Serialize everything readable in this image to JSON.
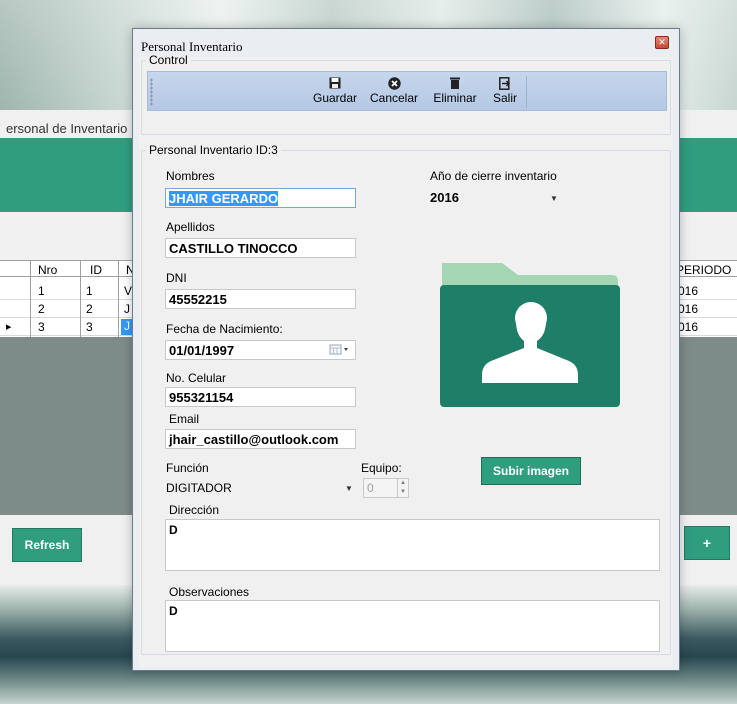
{
  "background": {
    "window_title": "ersonal de Inventario",
    "grid": {
      "headers": [
        "Nro",
        "ID",
        "N",
        "PERIODO"
      ],
      "rows": [
        {
          "nro": "1",
          "id": "1",
          "n": "V",
          "periodo": "016"
        },
        {
          "nro": "2",
          "id": "2",
          "n": "J",
          "periodo": "016"
        },
        {
          "nro": "3",
          "id": "3",
          "n": "J",
          "periodo": "016"
        }
      ]
    },
    "refresh_label": "Refresh",
    "add_label": "+",
    "accent_color": "#2f9e7f"
  },
  "dialog": {
    "title": "Personal Inventario",
    "control_group": "Control",
    "toolbar": {
      "save_label": "Guardar",
      "cancel_label": "Cancelar",
      "delete_label": "Eliminar",
      "exit_label": "Salir"
    },
    "form_group": "Personal Inventario ID:3",
    "fields": {
      "nombres_label": "Nombres",
      "nombres_value": "JHAIR GERARDO",
      "apellidos_label": "Apellidos",
      "apellidos_value": "CASTILLO TINOCCO",
      "dni_label": "DNI",
      "dni_value": "45552215",
      "fecha_label": "Fecha de Nacimiento:",
      "fecha_value": "01/01/1997",
      "celular_label": "No. Celular",
      "celular_value": "955321154",
      "email_label": "Email",
      "email_value": "jhair_castillo@outlook.com",
      "funcion_label": "Función",
      "funcion_value": "DIGITADOR",
      "equipo_label": "Equipo:",
      "equipo_value": "0",
      "direccion_label": "Dirección",
      "direccion_value": "D",
      "observaciones_label": "Observaciones",
      "observaciones_value": "D",
      "anio_label": "Año de cierre inventario",
      "anio_value": "2016"
    },
    "upload_label": "Subir imagen",
    "icons": {
      "save": "floppy-disk-icon",
      "cancel": "cancel-x-icon",
      "delete": "trash-icon",
      "exit": "exit-door-icon",
      "calendar": "calendar-icon",
      "photo": "folder-user-icon"
    }
  }
}
